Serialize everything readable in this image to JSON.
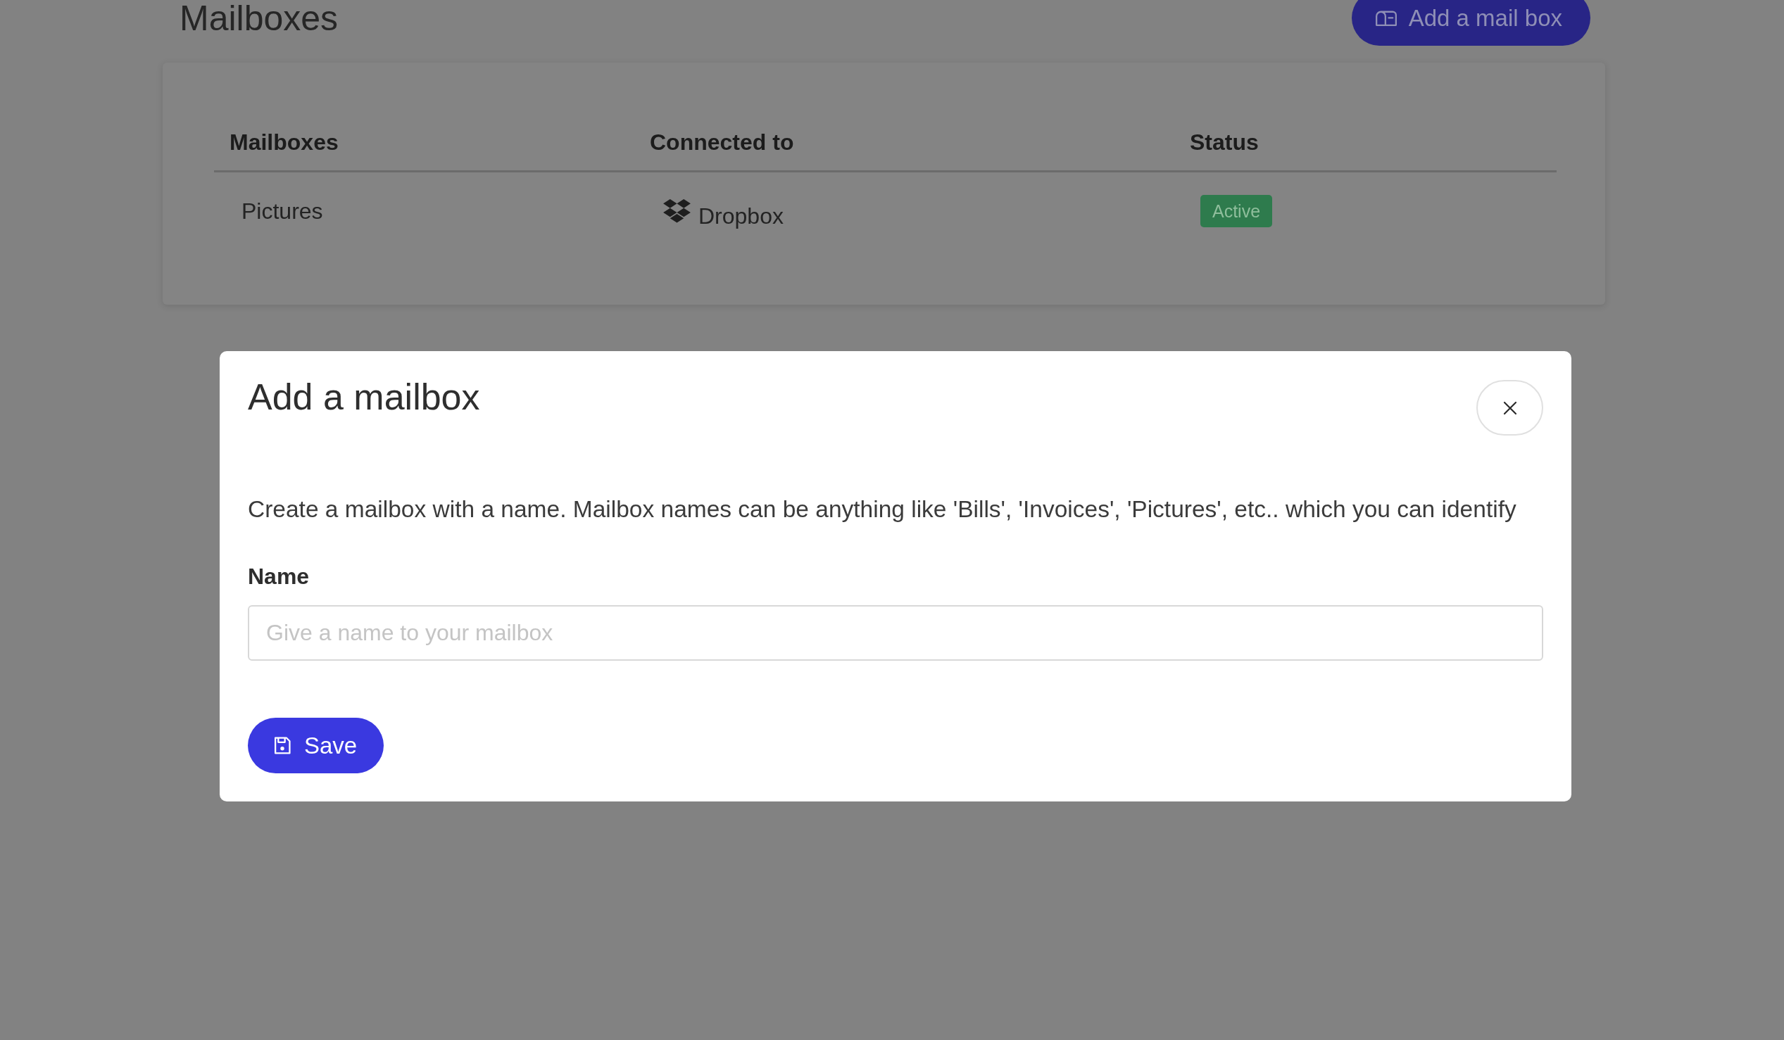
{
  "page": {
    "title": "Mailboxes",
    "add_button": "Add a mail box"
  },
  "table": {
    "columns": [
      "Mailboxes",
      "Connected to",
      "Status"
    ],
    "rows": [
      {
        "mailbox": "Pictures",
        "connected_to": "Dropbox",
        "status": {
          "label": "Active",
          "color": "#2e7b4d"
        }
      }
    ]
  },
  "modal": {
    "title": "Add a mailbox",
    "description": "Create a mailbox with a name. Mailbox names can be anything like 'Bills', 'Invoices', 'Pictures', etc.. which you can identify",
    "field": {
      "label": "Name",
      "placeholder": "Give a name to your mailbox"
    },
    "save_button": "Save"
  }
}
